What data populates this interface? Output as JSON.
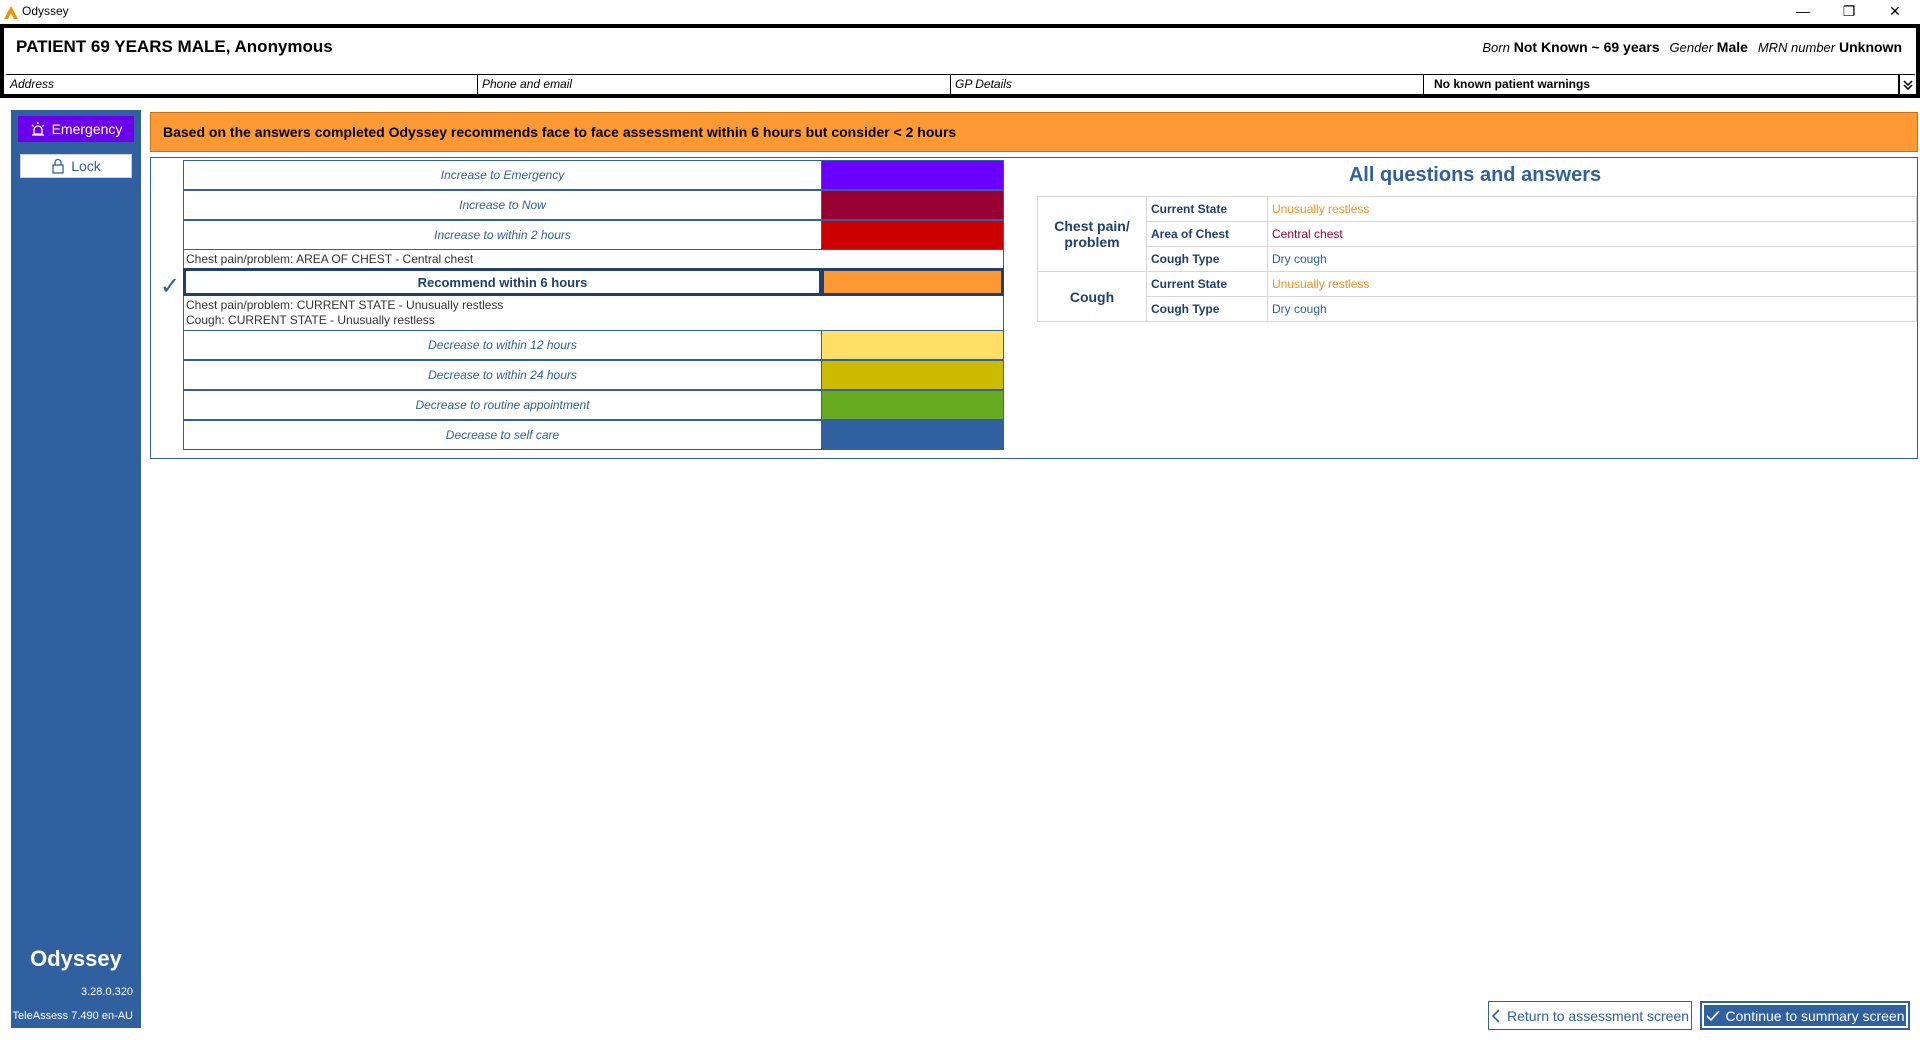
{
  "window": {
    "title": "Odyssey",
    "minimize": "—",
    "maximize": "❐",
    "close": "✕"
  },
  "patient": {
    "name": "PATIENT 69 YEARS MALE, Anonymous",
    "born_label": "Born",
    "born_value": "Not Known ~ 69 years",
    "gender_label": "Gender",
    "gender_value": "Male",
    "mrn_label": "MRN number",
    "mrn_value": "Unknown",
    "address_label": "Address",
    "phone_label": "Phone and email",
    "gp_label": "GP Details",
    "warnings": "No known patient warnings"
  },
  "sidebar": {
    "emergency": "Emergency",
    "lock": "Lock",
    "brand": "Odyssey",
    "version": "3.28.0.320",
    "teleassess": "TeleAssess 7.490 en-AU"
  },
  "banner": "Based on the answers completed Odyssey recommends face to face assessment within 6 hours but consider < 2 hours",
  "ladder": {
    "levels": [
      {
        "label": "Increase to Emergency",
        "color": "#6a00ff"
      },
      {
        "label": "Increase to Now",
        "color": "#990033"
      },
      {
        "label": "Increase to within 2 hours",
        "color": "#cc0000"
      },
      {
        "label": "Recommend within 6 hours",
        "color": "#ff9933"
      },
      {
        "label": "Decrease to within 12 hours",
        "color": "#ffe066"
      },
      {
        "label": "Decrease to within 24 hours",
        "color": "#ccbb00"
      },
      {
        "label": "Decrease to routine appointment",
        "color": "#66aa22"
      },
      {
        "label": "Decrease to self care",
        "color": "#30609f"
      }
    ],
    "note_2h": "Chest pain/problem: AREA OF CHEST - Central chest",
    "note_6h_1": "Chest pain/problem: CURRENT STATE - Unusually restless",
    "note_6h_2": "Cough: CURRENT STATE - Unusually restless",
    "check": "✓"
  },
  "qa": {
    "title": "All questions and answers",
    "sections": [
      {
        "name": "Chest pain/ problem",
        "rows": [
          {
            "question": "Current State",
            "answer": "Unusually restless",
            "color": "#ff8c1a"
          },
          {
            "question": "Area of Chest",
            "answer": "Central chest",
            "color": "#990033"
          },
          {
            "question": "Cough Type",
            "answer": "Dry cough",
            "color": "#30609f"
          }
        ]
      },
      {
        "name": "Cough",
        "rows": [
          {
            "question": "Current State",
            "answer": "Unusually restless",
            "color": "#ff8c1a"
          },
          {
            "question": "Cough Type",
            "answer": "Dry cough",
            "color": "#30609f"
          }
        ]
      }
    ]
  },
  "buttons": {
    "return": "Return to assessment screen",
    "continue": "Continue to summary screen"
  }
}
